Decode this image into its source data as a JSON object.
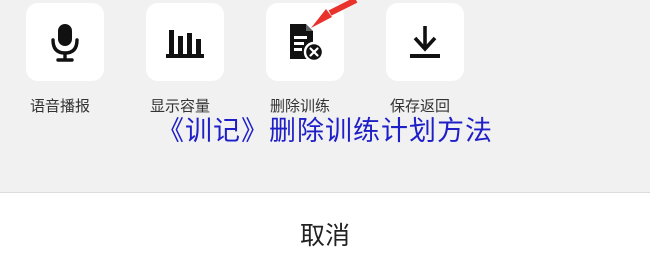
{
  "actions": [
    {
      "label": "语音播报",
      "icon": "microphone-icon"
    },
    {
      "label": "显示容量",
      "icon": "bar-chart-icon"
    },
    {
      "label": "删除训练",
      "icon": "delete-document-icon"
    },
    {
      "label": "保存返回",
      "icon": "download-icon"
    }
  ],
  "overlay": {
    "title": "《训记》删除训练计划方法"
  },
  "cancel": {
    "label": "取消"
  },
  "colors": {
    "overlay_text": "#1f1fc8",
    "pointer_arrow": "#e8322b",
    "icon": "#111111"
  }
}
